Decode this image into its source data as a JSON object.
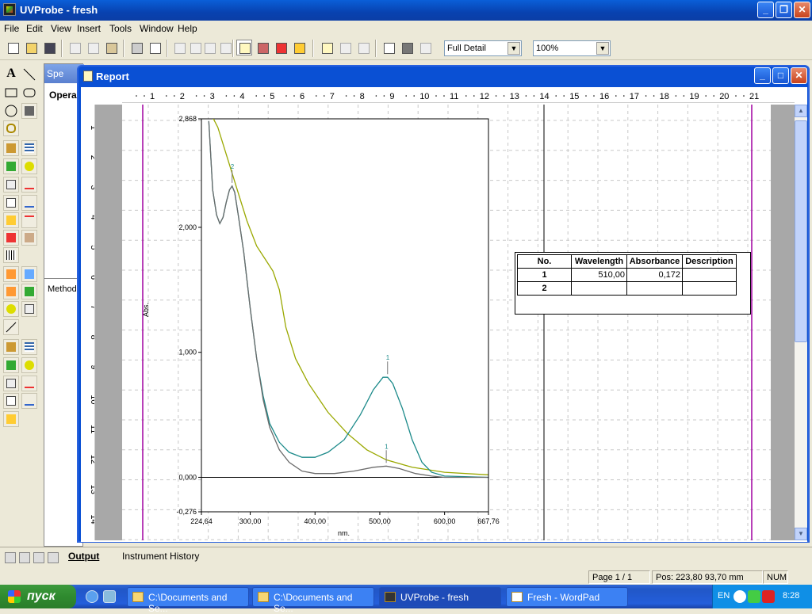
{
  "app": {
    "title": "UVProbe - fresh"
  },
  "menu": [
    "File",
    "Edit",
    "View",
    "Insert",
    "Tools",
    "Window",
    "Help"
  ],
  "toolbar": {
    "detail_value": "Full Detail",
    "zoom_value": "100%"
  },
  "spectrum_panel": {
    "title": "Spe",
    "operation": "Opera",
    "method": "Method"
  },
  "report": {
    "title": "Report"
  },
  "ruler": {
    "h": [
      "1",
      "2",
      "3",
      "4",
      "5",
      "6",
      "7",
      "8",
      "9",
      "10",
      "11",
      "12",
      "13",
      "14",
      "15",
      "16",
      "17",
      "18",
      "19",
      "20",
      "21"
    ],
    "v": [
      "1",
      "2",
      "3",
      "4",
      "5",
      "6",
      "7",
      "8",
      "9",
      "10",
      "11",
      "12",
      "13",
      "14",
      "15"
    ]
  },
  "chart_data": {
    "type": "line",
    "xlabel": "nm.",
    "ylabel": "Abs.",
    "xlim": [
      224.64,
      667.76
    ],
    "ylim": [
      -0.276,
      2.868
    ],
    "x_ticks": [
      "224,64",
      "300,00",
      "400,00",
      "500,00",
      "600,00",
      "667,76"
    ],
    "y_ticks": [
      "2,868",
      "2,000",
      "1,000",
      "0,000",
      "-0,276"
    ],
    "peak_labels": [
      "2",
      "1",
      "1"
    ],
    "series": [
      {
        "color": "#9aa800",
        "points": [
          [
            235,
            2.95
          ],
          [
            250,
            2.8
          ],
          [
            265,
            2.55
          ],
          [
            280,
            2.3
          ],
          [
            295,
            2.05
          ],
          [
            310,
            1.85
          ],
          [
            325,
            1.73
          ],
          [
            335,
            1.65
          ],
          [
            345,
            1.5
          ],
          [
            355,
            1.2
          ],
          [
            370,
            0.95
          ],
          [
            390,
            0.75
          ],
          [
            420,
            0.52
          ],
          [
            450,
            0.35
          ],
          [
            480,
            0.22
          ],
          [
            510,
            0.14
          ],
          [
            550,
            0.08
          ],
          [
            600,
            0.04
          ],
          [
            667,
            0.02
          ]
        ]
      },
      {
        "color": "#1c8a8a",
        "points": [
          [
            236,
            2.85
          ],
          [
            242,
            2.3
          ],
          [
            248,
            2.1
          ],
          [
            253,
            2.03
          ],
          [
            258,
            2.08
          ],
          [
            263,
            2.2
          ],
          [
            268,
            2.3
          ],
          [
            272,
            2.33
          ],
          [
            276,
            2.28
          ],
          [
            282,
            2.08
          ],
          [
            290,
            1.8
          ],
          [
            300,
            1.35
          ],
          [
            310,
            0.95
          ],
          [
            320,
            0.65
          ],
          [
            330,
            0.43
          ],
          [
            345,
            0.28
          ],
          [
            360,
            0.2
          ],
          [
            380,
            0.16
          ],
          [
            400,
            0.16
          ],
          [
            420,
            0.2
          ],
          [
            445,
            0.3
          ],
          [
            470,
            0.5
          ],
          [
            490,
            0.7
          ],
          [
            505,
            0.8
          ],
          [
            512,
            0.8
          ],
          [
            520,
            0.75
          ],
          [
            535,
            0.55
          ],
          [
            550,
            0.3
          ],
          [
            565,
            0.12
          ],
          [
            580,
            0.04
          ],
          [
            600,
            0.01
          ],
          [
            667,
            0.0
          ]
        ]
      },
      {
        "color": "#6b6b6b",
        "points": [
          [
            236,
            2.85
          ],
          [
            242,
            2.3
          ],
          [
            248,
            2.1
          ],
          [
            253,
            2.03
          ],
          [
            258,
            2.08
          ],
          [
            263,
            2.2
          ],
          [
            268,
            2.3
          ],
          [
            272,
            2.33
          ],
          [
            276,
            2.28
          ],
          [
            282,
            2.08
          ],
          [
            290,
            1.8
          ],
          [
            300,
            1.35
          ],
          [
            310,
            0.95
          ],
          [
            320,
            0.62
          ],
          [
            330,
            0.4
          ],
          [
            345,
            0.22
          ],
          [
            360,
            0.12
          ],
          [
            380,
            0.05
          ],
          [
            400,
            0.03
          ],
          [
            430,
            0.03
          ],
          [
            460,
            0.05
          ],
          [
            490,
            0.08
          ],
          [
            510,
            0.09
          ],
          [
            530,
            0.07
          ],
          [
            555,
            0.03
          ],
          [
            580,
            0.01
          ],
          [
            600,
            0.0
          ],
          [
            667,
            0.0
          ]
        ]
      }
    ]
  },
  "table": {
    "headers": [
      "No.",
      "Wavelength",
      "Absorbance",
      "Description"
    ],
    "rows": [
      [
        "1",
        "510,00",
        "0,172",
        ""
      ],
      [
        "2",
        "",
        "",
        ""
      ]
    ]
  },
  "tabs": {
    "output": "Output",
    "history": "Instrument History"
  },
  "status": {
    "page": "Page 1 / 1",
    "pos": "Pos: 223,80 93,70 mm",
    "num": "NUM"
  },
  "taskbar": {
    "start": "пуск",
    "tasks": [
      "C:\\Documents and Se...",
      "C:\\Documents and Se...",
      "UVProbe - fresh",
      "Fresh - WordPad"
    ],
    "lang": "EN",
    "clock": "8:28"
  }
}
